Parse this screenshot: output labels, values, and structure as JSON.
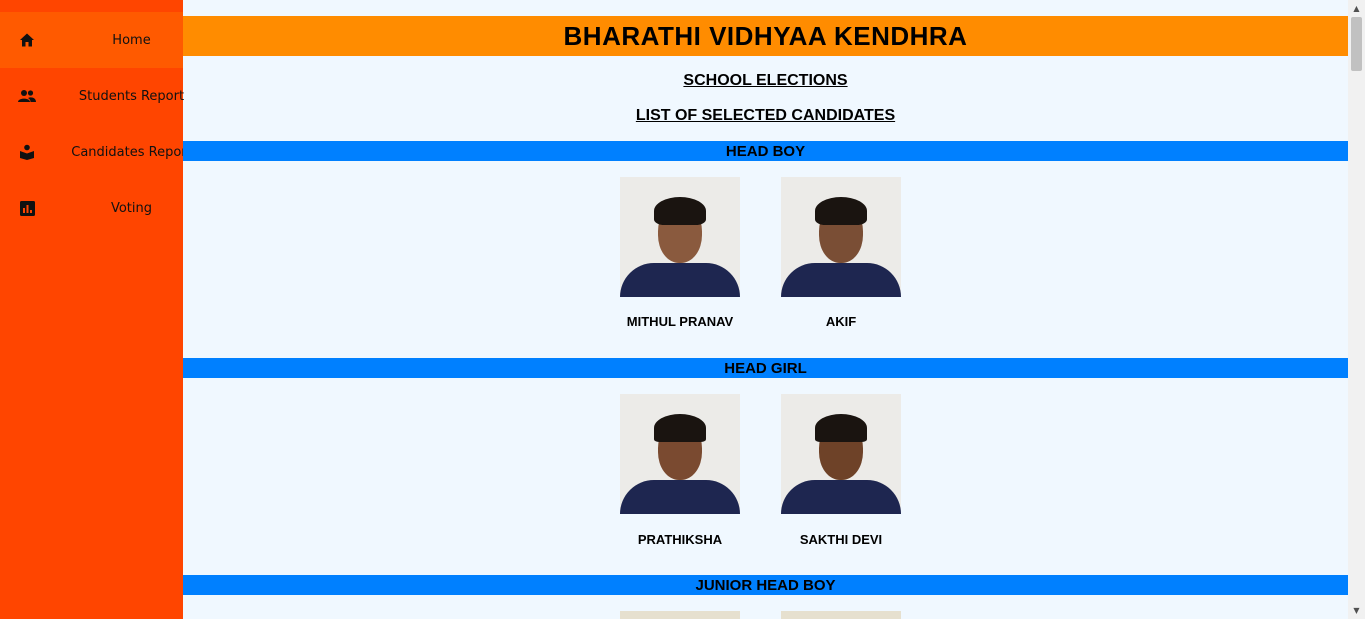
{
  "sidebar": {
    "items": [
      {
        "label": "Home",
        "icon": "home-icon"
      },
      {
        "label": "Students Report",
        "icon": "people-icon"
      },
      {
        "label": "Candidates Report",
        "icon": "book-icon"
      },
      {
        "label": "Voting",
        "icon": "bar-chart-icon"
      }
    ],
    "colors": {
      "background": "#ff4500",
      "active": "#ff5a00"
    }
  },
  "header": {
    "school_name": "BHARATHI VIDHYAA KENDHRA",
    "color": "#ff8c00"
  },
  "main": {
    "title": "SCHOOL ELECTIONS",
    "subtitle": "LIST OF SELECTED CANDIDATES",
    "section_color": "#0080ff",
    "sections": [
      {
        "title": "HEAD BOY",
        "candidates": [
          "MITHUL PRANAV",
          "AKIF"
        ]
      },
      {
        "title": "HEAD GIRL",
        "candidates": [
          "PRATHIKSHA",
          "SAKTHI DEVI"
        ]
      },
      {
        "title": "JUNIOR HEAD BOY",
        "candidates": []
      }
    ]
  }
}
